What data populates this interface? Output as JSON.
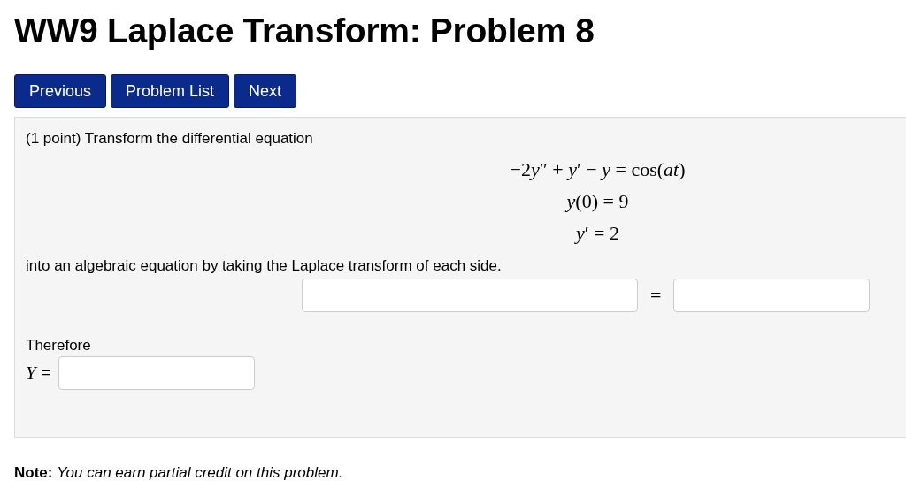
{
  "title": "WW9 Laplace Transform: Problem 8",
  "nav_buttons": [
    "Previous",
    "Problem List",
    "Next"
  ],
  "problem": {
    "intro": "(1 point) Transform the differential equation",
    "equations": [
      [
        "−2",
        "*y*″ + *y*′ − *y* = cos(*at*)"
      ],
      [
        "*y*(0) = 9"
      ],
      [
        "*y*′ = 2"
      ]
    ],
    "instruction": "into an algebraic equation by taking the Laplace transform of each side.",
    "equals_sign": "=",
    "therefore": "Therefore",
    "answer_label": "*Y* ="
  },
  "note": "**Note:** *You can earn partial credit on this problem.*"
}
